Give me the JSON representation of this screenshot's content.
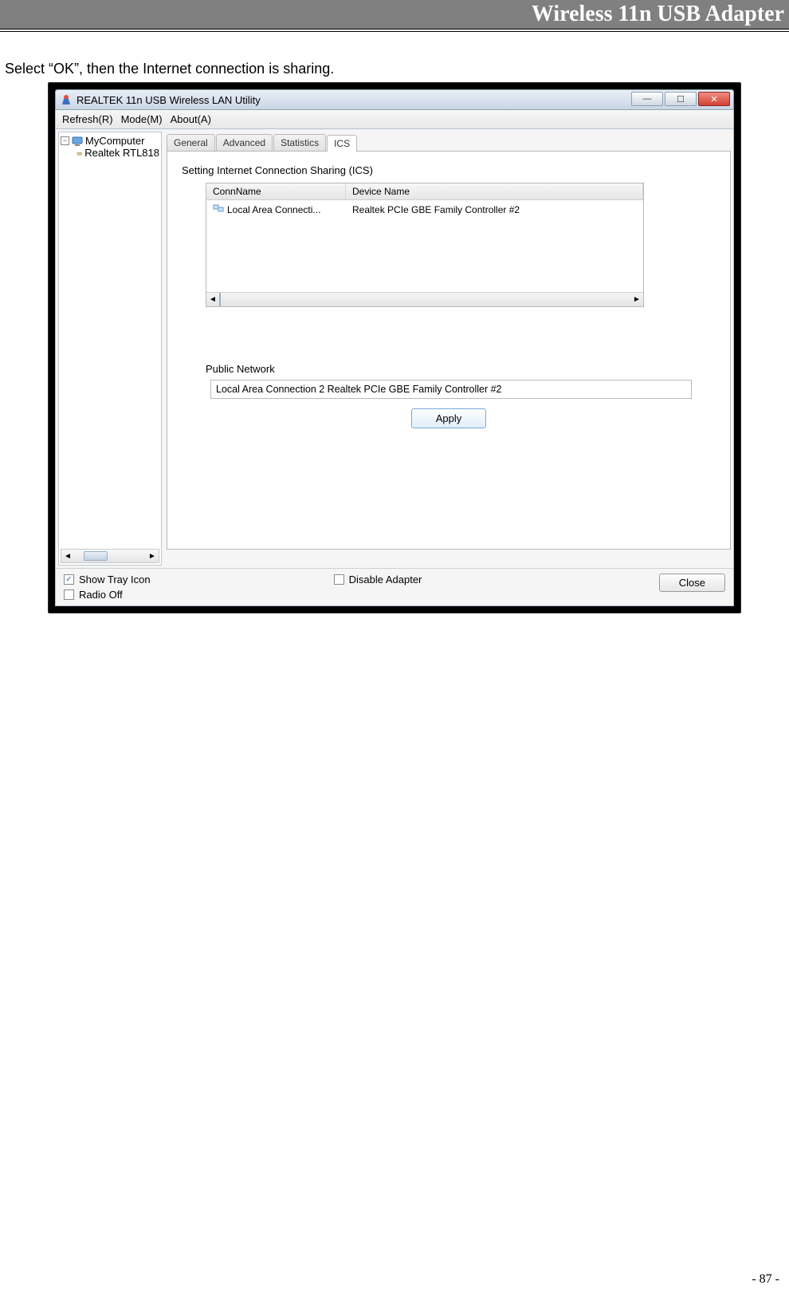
{
  "doc": {
    "header_title": "Wireless 11n USB Adapter",
    "body_text": "Select “OK”, then the Internet connection is sharing.",
    "page_number": "- 87 -"
  },
  "window": {
    "title": "REALTEK 11n USB Wireless LAN Utility",
    "menu": {
      "refresh": "Refresh(R)",
      "mode": "Mode(M)",
      "about": "About(A)"
    },
    "tree": {
      "root": "MyComputer",
      "child": "Realtek RTL818"
    },
    "tabs": {
      "general": "General",
      "advanced": "Advanced",
      "statistics": "Statistics",
      "ics": "ICS"
    },
    "ics": {
      "heading": "Setting Internet Connection Sharing (ICS)",
      "col_conn": "ConnName",
      "col_device": "Device Name",
      "row_conn": "Local Area Connecti...",
      "row_device": "Realtek PCIe GBE Family Controller #2",
      "public_label": "Public Network",
      "public_value": "Local Area Connection 2 Realtek PCIe GBE Family Controller #2",
      "apply": "Apply"
    },
    "bottom": {
      "show_tray": "Show Tray Icon",
      "radio_off": "Radio Off",
      "disable_adapter": "Disable Adapter",
      "close": "Close"
    }
  }
}
